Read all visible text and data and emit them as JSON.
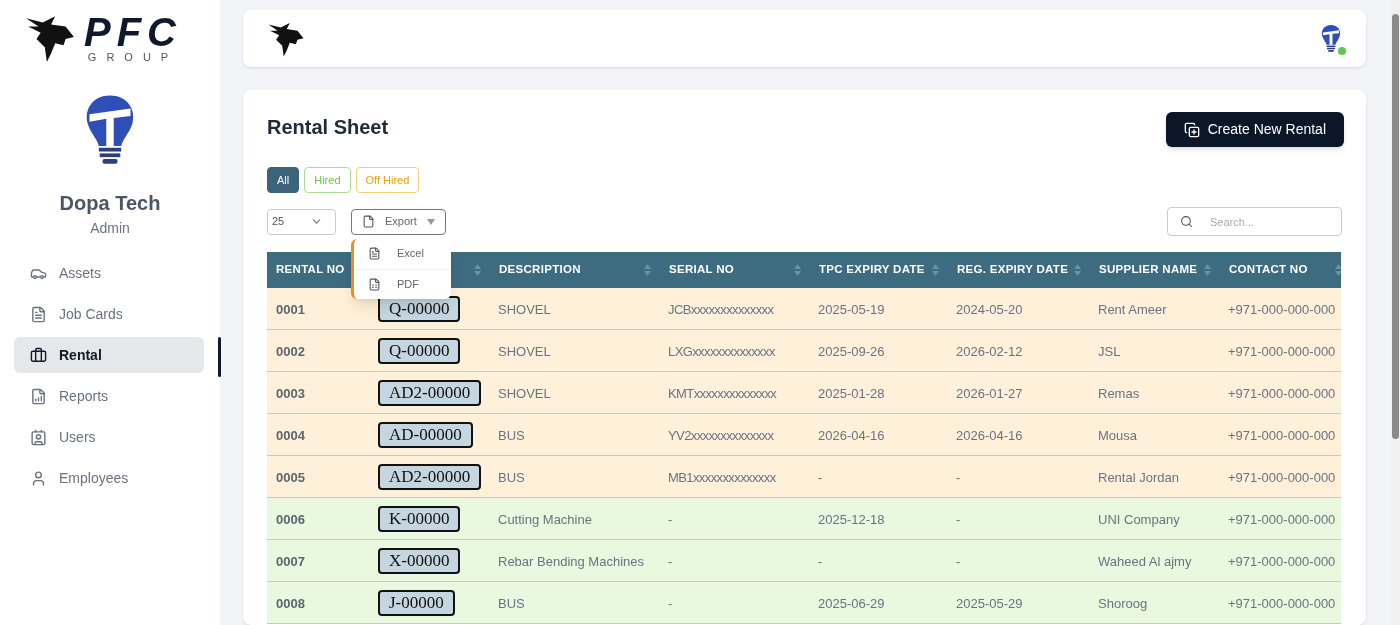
{
  "brand": {
    "name": "PFC",
    "tagline": "GROUP"
  },
  "profile": {
    "name": "Dopa Tech",
    "role": "Admin"
  },
  "sidebar": {
    "items": [
      {
        "label": "Assets",
        "kind": "car",
        "selected": false
      },
      {
        "label": "Job Cards",
        "kind": "card",
        "selected": false
      },
      {
        "label": "Rental",
        "kind": "briefcase",
        "selected": true
      },
      {
        "label": "Reports",
        "kind": "report",
        "selected": false
      },
      {
        "label": "Users",
        "kind": "users",
        "selected": false
      },
      {
        "label": "Employees",
        "kind": "person",
        "selected": false
      }
    ]
  },
  "topbar": {
    "user_online": true
  },
  "page": {
    "title": "Rental Sheet",
    "create_button": "Create New Rental"
  },
  "filters": [
    {
      "label": "All",
      "kind": "all",
      "selected": true
    },
    {
      "label": "Hired",
      "kind": "hired",
      "selected": false
    },
    {
      "label": "Off Hired",
      "kind": "off_hired",
      "selected": false
    }
  ],
  "page_size": "25",
  "export": {
    "label": "Export",
    "expanded": true,
    "options": [
      {
        "label": "Excel",
        "kind": "excel"
      },
      {
        "label": "PDF",
        "kind": "pdf"
      }
    ]
  },
  "search": {
    "placeholder": "Search..."
  },
  "table": {
    "columns": [
      "RENTAL NO",
      "DESCRIPTION",
      "SERIAL NO",
      "TPC EXPIRY DATE",
      "REG. EXPIRY DATE",
      "SUPPLIER NAME",
      "CONTACT NO"
    ],
    "rows": [
      {
        "kind": "off_hired",
        "rental_no": "0001",
        "plate": "Q-00000",
        "description": "SHOVEL",
        "serial_no": "JCBxxxxxxxxxxxxxx",
        "tpc_expiry": "2025-05-19",
        "reg_expiry": "2024-05-20",
        "supplier": "Rent Ameer",
        "contact": "+971-000-000-000"
      },
      {
        "kind": "off_hired",
        "rental_no": "0002",
        "plate": "Q-00000",
        "description": "SHOVEL",
        "serial_no": "LXGxxxxxxxxxxxxxx",
        "tpc_expiry": "2025-09-26",
        "reg_expiry": "2026-02-12",
        "supplier": "JSL",
        "contact": "+971-000-000-000"
      },
      {
        "kind": "off_hired",
        "rental_no": "0003",
        "plate": "AD2-00000",
        "description": "SHOVEL",
        "serial_no": "KMTxxxxxxxxxxxxxx",
        "tpc_expiry": "2025-01-28",
        "reg_expiry": "2026-01-27",
        "supplier": "Remas",
        "contact": "+971-000-000-000"
      },
      {
        "kind": "off_hired",
        "rental_no": "0004",
        "plate": "AD-00000",
        "description": "BUS",
        "serial_no": "YV2xxxxxxxxxxxxxx",
        "tpc_expiry": "2026-04-16",
        "reg_expiry": "2026-04-16",
        "supplier": "Mousa",
        "contact": "+971-000-000-000"
      },
      {
        "kind": "off_hired",
        "rental_no": "0005",
        "plate": "AD2-00000",
        "description": "BUS",
        "serial_no": "MB1xxxxxxxxxxxxxx",
        "tpc_expiry": "-",
        "reg_expiry": "-",
        "supplier": "Rental Jordan",
        "contact": "+971-000-000-000"
      },
      {
        "kind": "hired",
        "rental_no": "0006",
        "plate": "K-00000",
        "description": "Cutting Machine",
        "serial_no": "-",
        "tpc_expiry": "2025-12-18",
        "reg_expiry": "-",
        "supplier": "UNI Company",
        "contact": "+971-000-000-000"
      },
      {
        "kind": "hired",
        "rental_no": "0007",
        "plate": "X-00000",
        "description": "Rebar Bending Machines",
        "serial_no": "-",
        "tpc_expiry": "-",
        "reg_expiry": "-",
        "supplier": "Waheed Al ajmy",
        "contact": "+971-000-000-000"
      },
      {
        "kind": "hired",
        "rental_no": "0008",
        "plate": "J-00000",
        "description": "BUS",
        "serial_no": "-",
        "tpc_expiry": "2025-06-29",
        "reg_expiry": "2025-05-29",
        "supplier": "Shoroog",
        "contact": "+971-000-000-000"
      }
    ]
  }
}
